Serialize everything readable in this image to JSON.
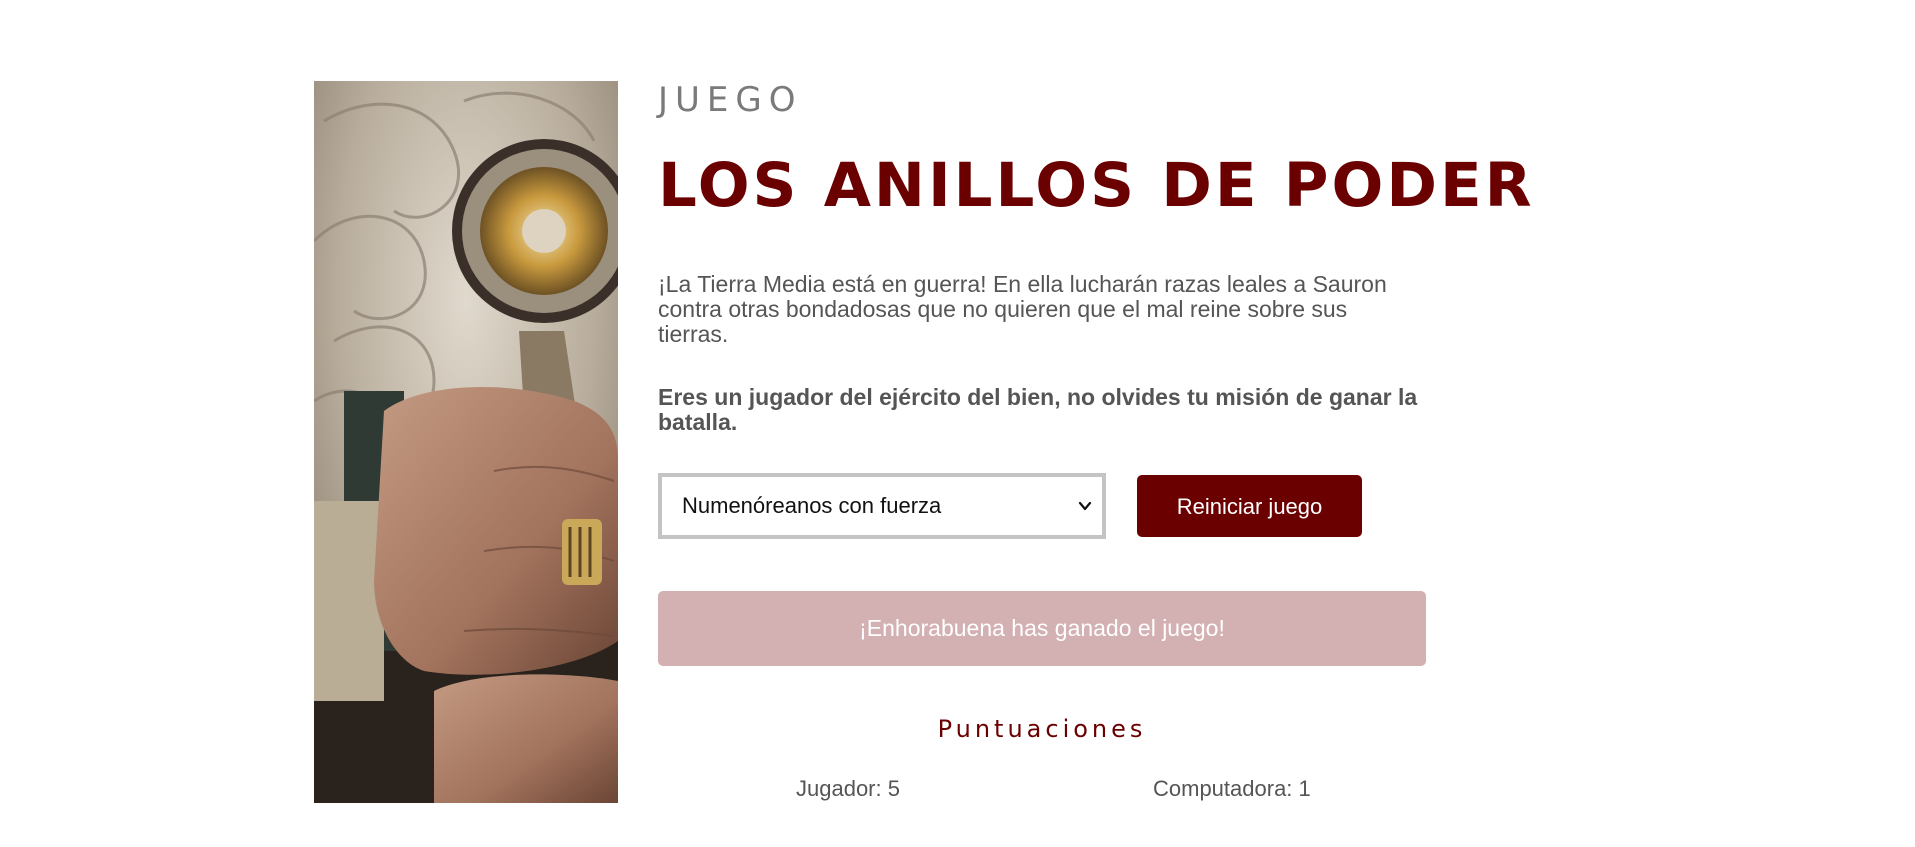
{
  "header": {
    "eyebrow": "JUEGO",
    "title": "LOS ANILLOS DE PODER"
  },
  "intro": {
    "lead": "¡La Tierra Media está en guerra! En ella lucharán razas leales a Sauron contra otras bondadosas que no quieren que el mal reine sobre sus tierras.",
    "mission": "Eres un jugador del ejército del bien, no olvides tu misión de ganar la batalla."
  },
  "controls": {
    "race_select": {
      "selected": "Numenóreanos con fuerza"
    },
    "reset_label": "Reiniciar juego"
  },
  "result": {
    "message": "¡Enhorabuena has ganado el juego!"
  },
  "scores": {
    "title": "Puntuaciones",
    "player_label": "Jugador: 5",
    "computer_label": "Computadora: 1"
  },
  "colors": {
    "brand": "#6b0000",
    "alert_bg": "#d3b0b2",
    "text": "#555555"
  },
  "icons": {
    "select_caret": "chevron-down-icon"
  }
}
